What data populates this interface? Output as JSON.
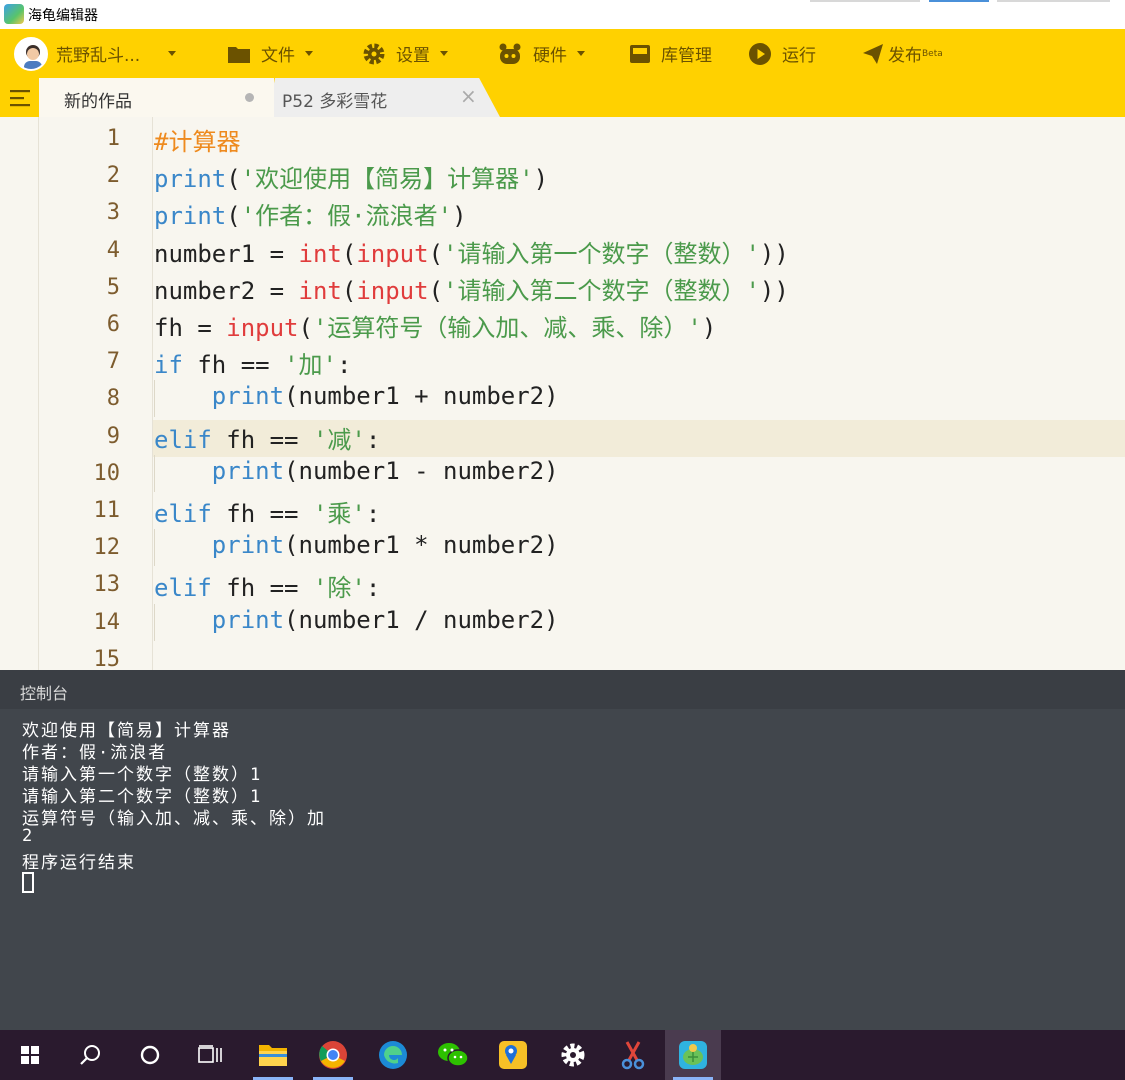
{
  "window": {
    "title": "海龟编辑器"
  },
  "menu": {
    "user": "荒野乱斗...",
    "file": "文件",
    "settings": "设置",
    "hardware": "硬件",
    "library": "库管理",
    "run": "运行",
    "publish": "发布",
    "publish_badge": "Beta"
  },
  "tabs": [
    {
      "label": "新的作品"
    },
    {
      "label": "P52 多彩雪花"
    }
  ],
  "editor": {
    "line_numbers": [
      "1",
      "2",
      "3",
      "4",
      "5",
      "6",
      "7",
      "8",
      "9",
      "10",
      "11",
      "12",
      "13",
      "14",
      "15"
    ],
    "lines": [
      [
        {
          "t": "#计算器",
          "c": "cmt"
        }
      ],
      [
        {
          "t": "print",
          "c": "kw"
        },
        {
          "t": "(",
          "c": ""
        },
        {
          "t": "'欢迎使用【简易】计算器'",
          "c": "str"
        },
        {
          "t": ")",
          "c": ""
        }
      ],
      [
        {
          "t": "print",
          "c": "kw"
        },
        {
          "t": "(",
          "c": ""
        },
        {
          "t": "'作者：假·流浪者'",
          "c": "str"
        },
        {
          "t": ")",
          "c": ""
        }
      ],
      [
        {
          "t": "number1 = ",
          "c": ""
        },
        {
          "t": "int",
          "c": "bi"
        },
        {
          "t": "(",
          "c": ""
        },
        {
          "t": "input",
          "c": "bi"
        },
        {
          "t": "(",
          "c": ""
        },
        {
          "t": "'请输入第一个数字（整数）'",
          "c": "str"
        },
        {
          "t": "))",
          "c": ""
        }
      ],
      [
        {
          "t": "number2 = ",
          "c": ""
        },
        {
          "t": "int",
          "c": "bi"
        },
        {
          "t": "(",
          "c": ""
        },
        {
          "t": "input",
          "c": "bi"
        },
        {
          "t": "(",
          "c": ""
        },
        {
          "t": "'请输入第二个数字（整数）'",
          "c": "str"
        },
        {
          "t": "))",
          "c": ""
        }
      ],
      [
        {
          "t": "fh = ",
          "c": ""
        },
        {
          "t": "input",
          "c": "bi"
        },
        {
          "t": "(",
          "c": ""
        },
        {
          "t": "'运算符号（输入加、减、乘、除）'",
          "c": "str"
        },
        {
          "t": ")",
          "c": ""
        }
      ],
      [
        {
          "t": "if",
          "c": "kw"
        },
        {
          "t": " fh == ",
          "c": ""
        },
        {
          "t": "'加'",
          "c": "str"
        },
        {
          "t": ":",
          "c": ""
        }
      ],
      [
        {
          "t": "    ",
          "c": ""
        },
        {
          "t": "print",
          "c": "kw"
        },
        {
          "t": "(number1 + number2)",
          "c": ""
        }
      ],
      [
        {
          "t": "elif",
          "c": "kw"
        },
        {
          "t": " fh == ",
          "c": ""
        },
        {
          "t": "'减'",
          "c": "str"
        },
        {
          "t": ":",
          "c": ""
        }
      ],
      [
        {
          "t": "    ",
          "c": ""
        },
        {
          "t": "print",
          "c": "kw"
        },
        {
          "t": "(number1 - number2)",
          "c": ""
        }
      ],
      [
        {
          "t": "elif",
          "c": "kw"
        },
        {
          "t": " fh == ",
          "c": ""
        },
        {
          "t": "'乘'",
          "c": "str"
        },
        {
          "t": ":",
          "c": ""
        }
      ],
      [
        {
          "t": "    ",
          "c": ""
        },
        {
          "t": "print",
          "c": "kw"
        },
        {
          "t": "(number1 * number2)",
          "c": ""
        }
      ],
      [
        {
          "t": "elif",
          "c": "kw"
        },
        {
          "t": " fh == ",
          "c": ""
        },
        {
          "t": "'除'",
          "c": "str"
        },
        {
          "t": ":",
          "c": ""
        }
      ],
      [
        {
          "t": "    ",
          "c": ""
        },
        {
          "t": "print",
          "c": "kw"
        },
        {
          "t": "(number1 / number2)",
          "c": ""
        }
      ],
      []
    ],
    "colors": {
      "comment": "#ee8a1e",
      "keyword": "#3a87c9",
      "builtin": "#e03c3c",
      "string": "#4b9a4b"
    }
  },
  "console": {
    "title": "控制台",
    "lines": [
      "欢迎使用【简易】计算器",
      "作者：假·流浪者",
      "请输入第一个数字（整数）1",
      "请输入第二个数字（整数）1",
      "运算符号（输入加、减、乘、除）加",
      "2",
      "程序运行结束"
    ]
  },
  "taskbar": {
    "icons": [
      "windows-start-icon",
      "search-icon",
      "cortana-icon",
      "task-view-icon",
      "file-explorer-icon",
      "chrome-icon",
      "edge-icon",
      "wechat-icon",
      "maps-icon",
      "settings-gear-icon",
      "snipping-tool-icon",
      "turtle-editor-icon"
    ]
  }
}
